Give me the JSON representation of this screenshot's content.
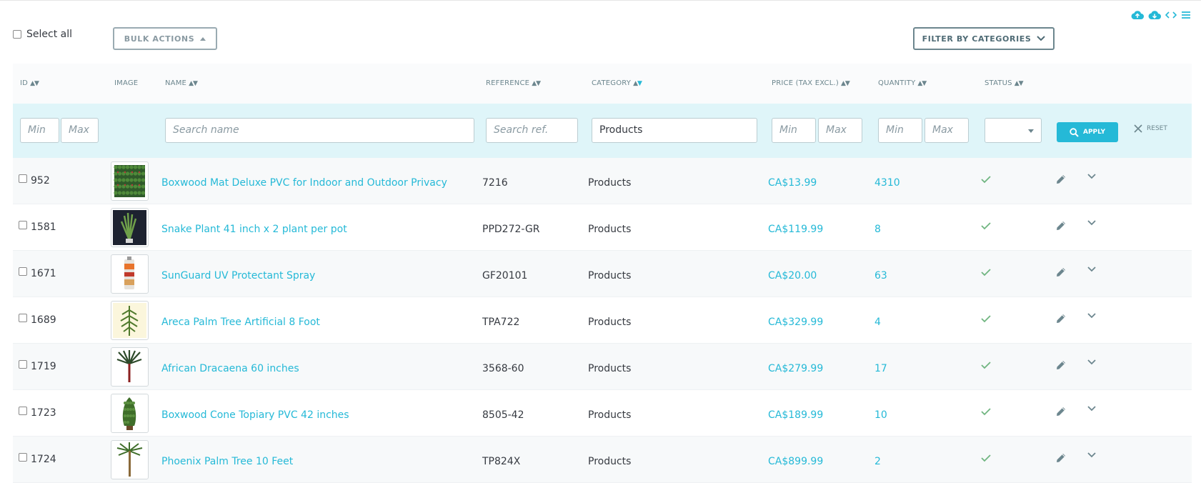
{
  "toolbar": {
    "select_all_label": "Select all",
    "bulk_actions_label": "BULK ACTIONS",
    "filter_categories_label": "FILTER BY CATEGORIES",
    "icons": [
      "cloud-upload-icon",
      "cloud-download-icon",
      "code-icon",
      "menu-icon"
    ]
  },
  "columns": {
    "id": "ID",
    "image": "IMAGE",
    "name": "NAME",
    "reference": "REFERENCE",
    "category": "CATEGORY",
    "price": "PRICE (TAX EXCL.)",
    "quantity": "QUANTITY",
    "status": "STATUS"
  },
  "filters": {
    "id_min_placeholder": "Min",
    "id_max_placeholder": "Max",
    "name_placeholder": "Search name",
    "ref_placeholder": "Search ref.",
    "category_value": "Products",
    "price_min_placeholder": "Min",
    "price_max_placeholder": "Max",
    "qty_min_placeholder": "Min",
    "qty_max_placeholder": "Max",
    "status_value": "",
    "apply_label": "APPLY",
    "reset_label": "RESET"
  },
  "products": [
    {
      "id": "952",
      "name": "Boxwood Mat Deluxe PVC for Indoor and Outdoor Privacy",
      "reference": "7216",
      "category": "Products",
      "price": "CA$13.99",
      "quantity": "4310",
      "thumb": "boxwood-mat"
    },
    {
      "id": "1581",
      "name": "Snake Plant 41 inch x 2 plant per pot",
      "reference": "PPD272-GR",
      "category": "Products",
      "price": "CA$119.99",
      "quantity": "8",
      "thumb": "snake-plant"
    },
    {
      "id": "1671",
      "name": "SunGuard UV Protectant Spray",
      "reference": "GF20101",
      "category": "Products",
      "price": "CA$20.00",
      "quantity": "63",
      "thumb": "spray-can"
    },
    {
      "id": "1689",
      "name": "Areca Palm Tree Artificial 8 Foot",
      "reference": "TPA722",
      "category": "Products",
      "price": "CA$329.99",
      "quantity": "4",
      "thumb": "areca-palm"
    },
    {
      "id": "1719",
      "name": "African Dracaena 60 inches",
      "reference": "3568-60",
      "category": "Products",
      "price": "CA$279.99",
      "quantity": "17",
      "thumb": "dracaena"
    },
    {
      "id": "1723",
      "name": "Boxwood Cone Topiary PVC 42 inches",
      "reference": "8505-42",
      "category": "Products",
      "price": "CA$189.99",
      "quantity": "10",
      "thumb": "cone-topiary"
    },
    {
      "id": "1724",
      "name": "Phoenix Palm Tree 10 Feet",
      "reference": "TP824X",
      "category": "Products",
      "price": "CA$899.99",
      "quantity": "2",
      "thumb": "phoenix-palm"
    }
  ],
  "colors": {
    "accent": "#25b9d7",
    "filter_row_bg": "#dff5f9",
    "status_ok": "#70b580"
  }
}
